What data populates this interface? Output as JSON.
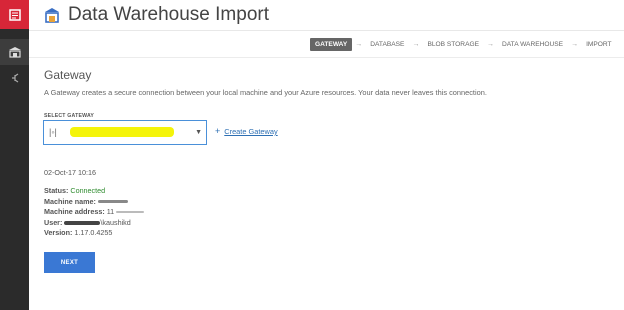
{
  "app": {
    "title": "Data Warehouse Import"
  },
  "steps": [
    {
      "label": "GATEWAY"
    },
    {
      "label": "DATABASE"
    },
    {
      "label": "BLOB STORAGE"
    },
    {
      "label": "DATA WAREHOUSE"
    },
    {
      "label": "IMPORT"
    }
  ],
  "step_arrow": "→",
  "gateway": {
    "heading": "Gateway",
    "description": "A Gateway creates a secure connection between your local machine and your Azure resources. Your data never leaves this connection.",
    "select_label": "SELECT GATEWAY",
    "select_value": "",
    "create_label": "Create Gateway",
    "create_plus": "+"
  },
  "details": {
    "name": "",
    "date": "02-Oct-17 10:16",
    "status_key": "Status:",
    "status_value": "Connected",
    "machine_name_key": "Machine name:",
    "machine_name_value": "",
    "machine_address_key": "Machine address:",
    "machine_address_value": "11",
    "user_key": "User:",
    "user_value": "\\kaushikd",
    "version_key": "Version:",
    "version_value": "1.17.0.4255"
  },
  "next_label": "NEXT",
  "colors": {
    "accent": "#3a78d4",
    "brand": "#d72638",
    "status_ok": "#2e8b2e",
    "highlight": "#f4f40a"
  }
}
